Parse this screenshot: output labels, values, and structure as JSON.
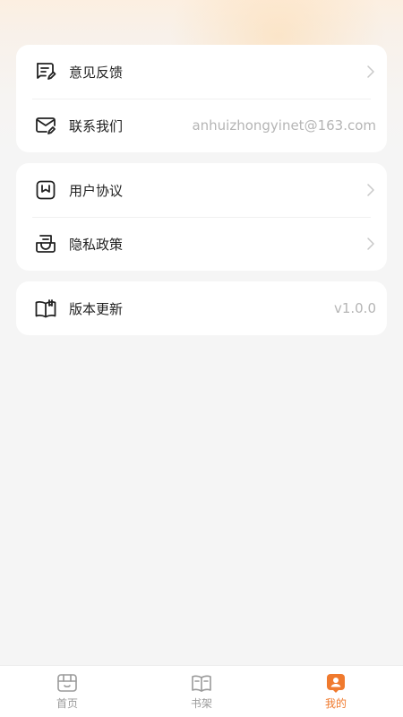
{
  "settings_groups": [
    {
      "items": [
        {
          "label": "意见反馈",
          "icon": "feedback-icon",
          "chevron": true
        },
        {
          "label": "联系我们",
          "icon": "mail-icon",
          "value": "anhuizhongyinet@163.com"
        }
      ]
    },
    {
      "items": [
        {
          "label": "用户协议",
          "icon": "agreement-icon",
          "chevron": true
        },
        {
          "label": "隐私政策",
          "icon": "privacy-icon",
          "chevron": true
        }
      ]
    },
    {
      "items": [
        {
          "label": "版本更新",
          "icon": "book-update-icon",
          "value": "v1.0.0"
        }
      ]
    }
  ],
  "tabbar": {
    "items": [
      {
        "label": "首页",
        "icon": "home-icon",
        "active": false
      },
      {
        "label": "书架",
        "icon": "bookshelf-icon",
        "active": false
      },
      {
        "label": "我的",
        "icon": "profile-icon",
        "active": true
      }
    ]
  },
  "colors": {
    "accent": "#f07a2e",
    "text": "#222222",
    "muted": "#b5b5b5",
    "tab_inactive": "#9a9a9a"
  }
}
